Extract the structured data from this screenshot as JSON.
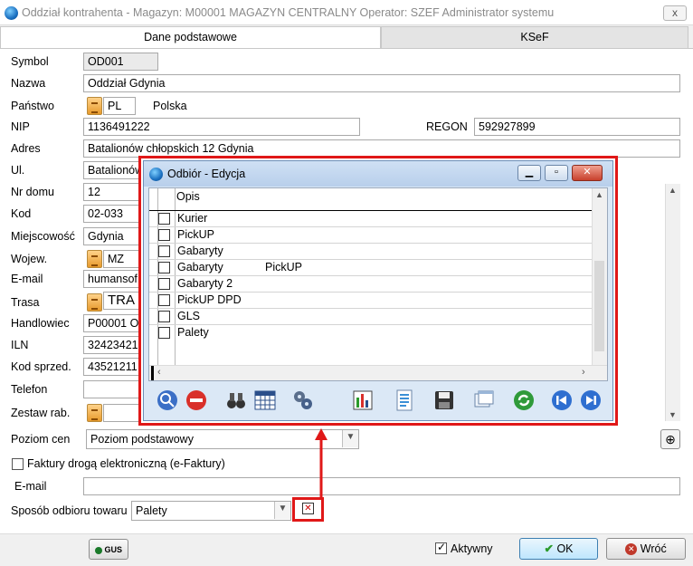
{
  "window": {
    "title": "Oddział kontrahenta - Magazyn: M00001 MAGAZYN CENTRALNY  Operator:  SZEF Administrator systemu",
    "close_glyph": "x"
  },
  "tabs": [
    {
      "label": "Dane podstawowe"
    },
    {
      "label": "KSeF"
    }
  ],
  "form": {
    "symbol_label": "Symbol",
    "symbol_value": "OD001",
    "nazwa_label": "Nazwa",
    "nazwa_value": "Oddział Gdynia",
    "panstwo_label": "Państwo",
    "panstwo_code": "PL",
    "panstwo_name": "Polska",
    "nip_label": "NIP",
    "nip_value": "1136491222",
    "regon_label": "REGON",
    "regon_value": "592927899",
    "adres_label": "Adres",
    "adres_value": "Batalionów chłopskich 12 Gdynia",
    "ul_label": "Ul.",
    "ul_value": "Batalionów",
    "nrdomu_label": "Nr domu",
    "nrdomu_value": "12",
    "kod_label": "Kod",
    "kod_value": "02-033",
    "miejsc_label": "Miejscowość",
    "miejsc_value": "Gdynia",
    "wojew_label": "Wojew.",
    "wojew_value": "MZ",
    "email_label": "E-mail",
    "email_value": "humansof",
    "trasa_label": "Trasa",
    "trasa_value": "TRA",
    "handl_label": "Handlowiec",
    "handl_value": "P00001 O",
    "iln_label": "ILN",
    "iln_value": "32423421",
    "kodsprzed_label": "Kod sprzed.",
    "kodsprzed_value": "43521211",
    "telefon_label": "Telefon",
    "telefon_value": "",
    "zestaw_label": "Zestaw rab.",
    "zestaw_value": "",
    "poziom_label": "Poziom cen",
    "poziom_value": "Poziom podstawowy",
    "efaktury_label": "Faktury drogą elektroniczną (e-Faktury)",
    "email2_label": "E-mail",
    "email2_value": "",
    "sposob_label": "Sposób odbioru towaru",
    "sposob_value": "Palety"
  },
  "bottom": {
    "gus_label": "GUS",
    "aktywny_label": "Aktywny",
    "ok_label": "OK",
    "wroc_label": "Wróć"
  },
  "dialog": {
    "title": "Odbiór - Edycja",
    "column_header": "Opis",
    "rows": [
      {
        "a": "Kurier",
        "b": ""
      },
      {
        "a": "PickUP",
        "b": ""
      },
      {
        "a": "Gabaryty",
        "b": ""
      },
      {
        "a": "Gabaryty",
        "b": "PickUP"
      },
      {
        "a": "Gabaryty 2",
        "b": ""
      },
      {
        "a": "PickUP DPD",
        "b": ""
      },
      {
        "a": "GLS",
        "b": ""
      },
      {
        "a": "Palety",
        "b": ""
      }
    ],
    "toolbar_icons": [
      "preview-icon",
      "delete-icon",
      "binoculars-icon",
      "calendar-grid-icon",
      "gears-icon",
      "chart-icon",
      "document-icon",
      "save-icon",
      "windows-icon",
      "refresh-icon",
      "prev-icon",
      "next-icon"
    ]
  },
  "colors": {
    "highlight_red": "#e01818",
    "dialog_bg": "#dbe8f6",
    "ok_check": "#2a9a2a",
    "wroc_x": "#c0392b"
  }
}
